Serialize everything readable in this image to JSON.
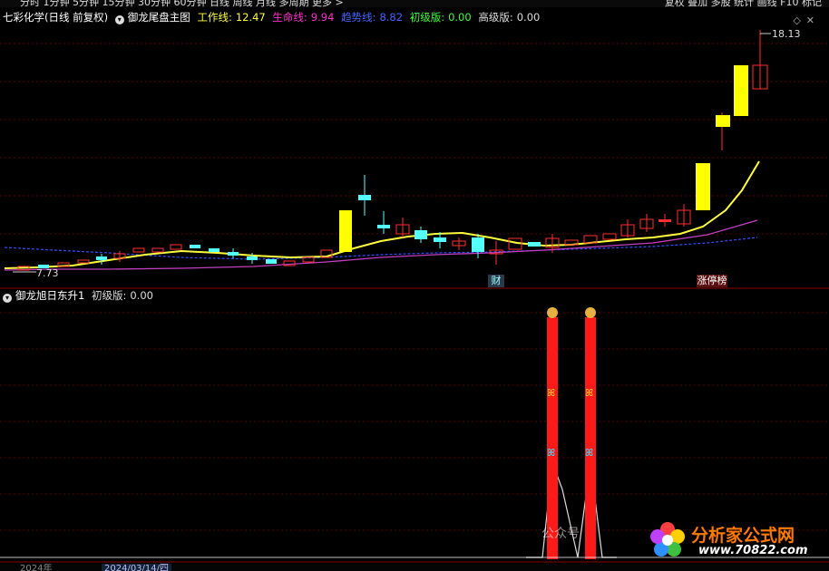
{
  "top_bar": {
    "left_partial": "分时  1分钟  5分钟  15分钟  30分钟  60分钟  日线  周线  月线  多周期  更多 >",
    "right_partial": "复权  叠加  多股  统计  画线  F10  标记"
  },
  "main_header": {
    "stock": "七彩化学(日线 前复权)",
    "indicator": "御龙尾盘主图",
    "work_label": "工作线:",
    "work_value": "12.47",
    "life_label": "生命线:",
    "life_value": "9.94",
    "trend_label": "趋势线:",
    "trend_value": "8.82",
    "basic_label": "初级版:",
    "basic_value": "0.00",
    "advanced_label": "高级版:",
    "advanced_value": "0.00"
  },
  "sub_header": {
    "indicator": "御龙旭日东升1",
    "basic_label": "初级版:",
    "basic_value": "0.00"
  },
  "price_labels": {
    "high": "18.13",
    "low": "7.73"
  },
  "markers": {
    "cai": "财",
    "zhangting": "涨停榜"
  },
  "bottom_bar": {
    "left": "2024年",
    "date": "2024/03/14/四"
  },
  "watermark": "公众号",
  "brand": {
    "name": "分析家公式网",
    "url": "www.70822.com"
  },
  "colors": {
    "up": "#ff3030",
    "down": "#54ffff",
    "limit_up": "#ffff00",
    "work_line": "#ffff40",
    "life_line": "#c040c0",
    "trend_line": "#4060ff",
    "signal_bar": "#ff1a1a"
  }
}
